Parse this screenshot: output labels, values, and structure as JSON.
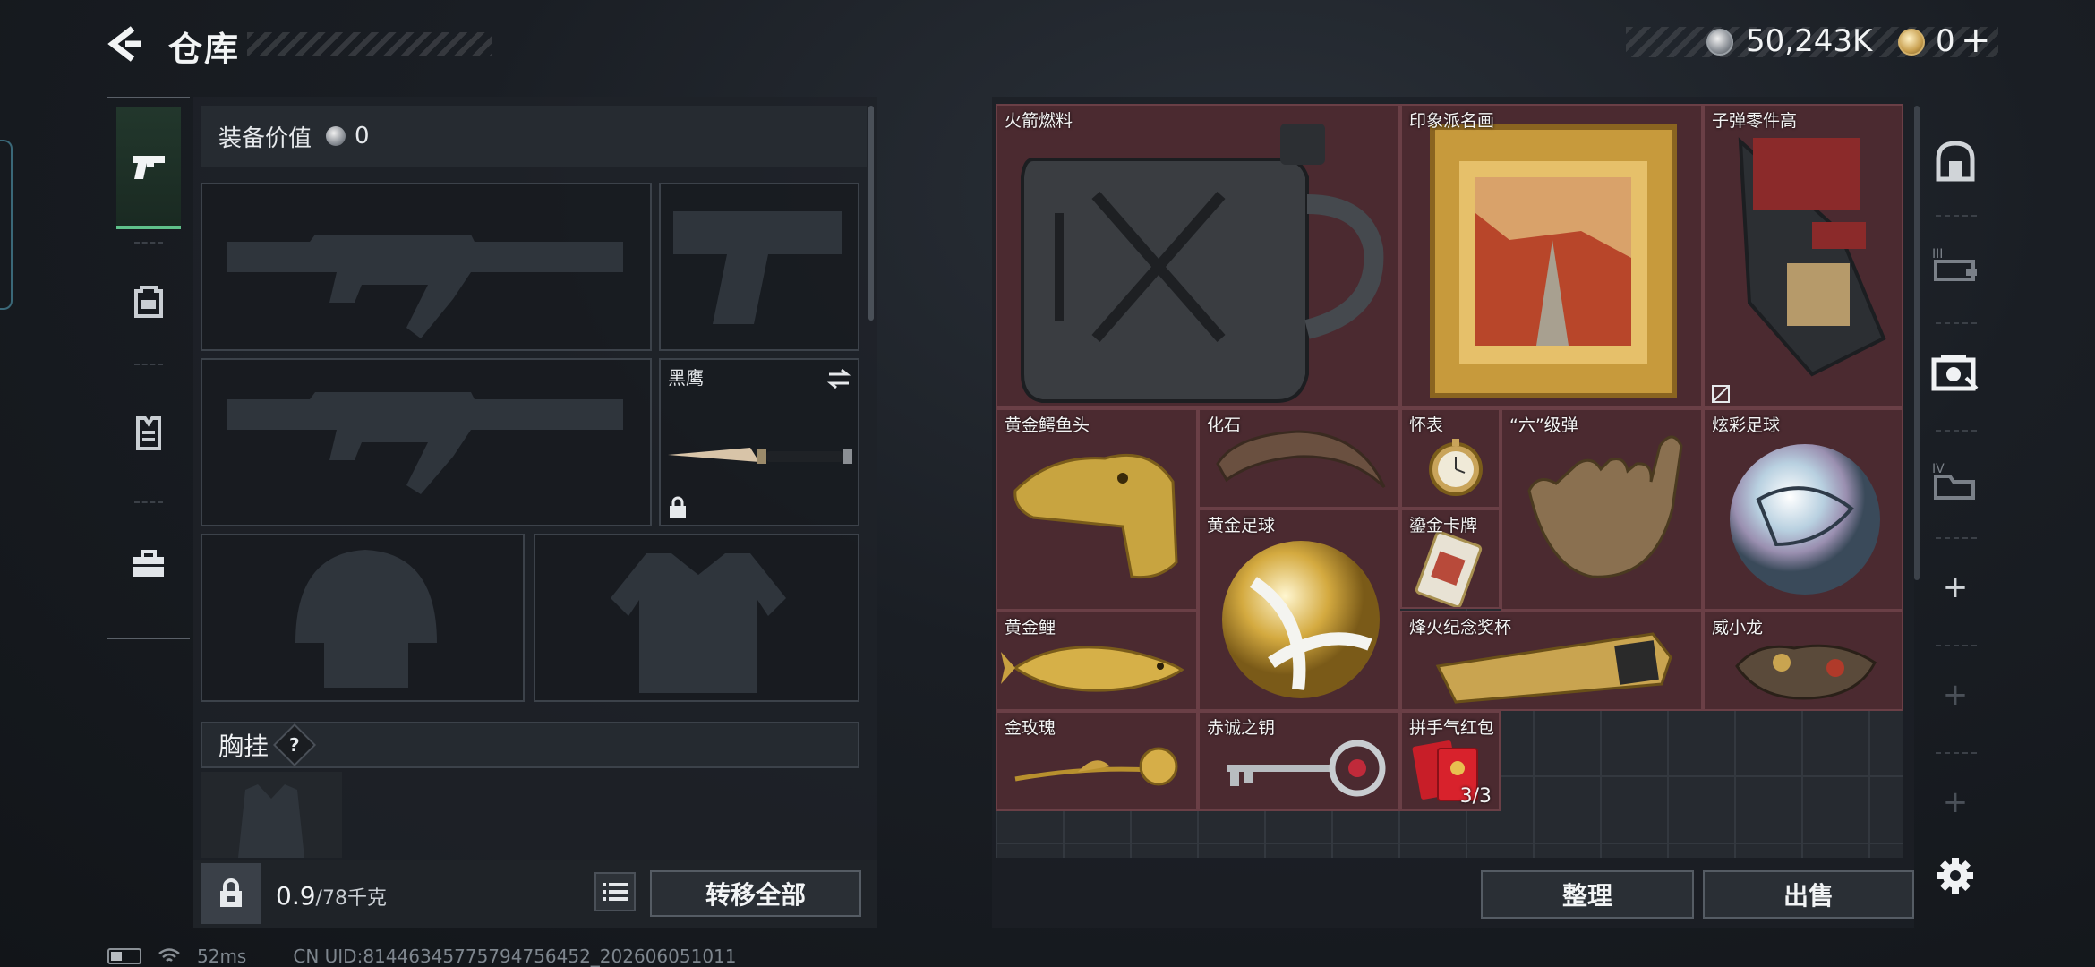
{
  "header": {
    "title": "仓库",
    "currency_silver": "50,243K",
    "currency_gold": "0",
    "gold_plus": "+"
  },
  "left_rail": {
    "tabs": [
      {
        "icon": "pistol-icon",
        "active": true
      },
      {
        "icon": "backpack-icon",
        "active": false
      },
      {
        "icon": "vest-icon",
        "active": false
      },
      {
        "icon": "toolbox-icon",
        "active": false
      }
    ]
  },
  "equipment": {
    "value_label": "装备价值",
    "value": "0",
    "melee_name": "黑鹰",
    "rig_label": "胸挂",
    "help_mark": "?",
    "weight_current": "0.9",
    "weight_max": "/78千克",
    "transfer_all_label": "转移全部"
  },
  "storage": {
    "items": [
      {
        "name": "火箭燃料"
      },
      {
        "name": "印象派名画"
      },
      {
        "name": "子弹零件高"
      },
      {
        "name": "黄金鳄鱼头"
      },
      {
        "name": "化石"
      },
      {
        "name": "怀表"
      },
      {
        "name": "“六”级弹"
      },
      {
        "name": "炫彩足球"
      },
      {
        "name": "黄金足球"
      },
      {
        "name": "鎏金卡牌"
      },
      {
        "name": "黄金鲤"
      },
      {
        "name": "烽火纪念奖杯"
      },
      {
        "name": "威小龙"
      },
      {
        "name": "金玫瑰"
      },
      {
        "name": "赤诚之钥"
      },
      {
        "name": "拼手气红包",
        "count": "3/3"
      }
    ],
    "organize_label": "整理",
    "sell_label": "出售"
  },
  "right_rail": {
    "tabs": [
      {
        "icon": "safe-box-icon"
      },
      {
        "icon": "storage-iii-icon",
        "label": "III"
      },
      {
        "icon": "storage-active-icon"
      },
      {
        "icon": "storage-iv-icon",
        "label": "IV"
      }
    ],
    "plus": "+"
  },
  "status_bar": {
    "ping": "52ms",
    "uid": "CN UID:8144634577579475645​2_202606051011"
  },
  "colors": {
    "item_bg": "#4b2a30",
    "active_tab": "#5fc08a",
    "grid_bg": "#262a30"
  }
}
